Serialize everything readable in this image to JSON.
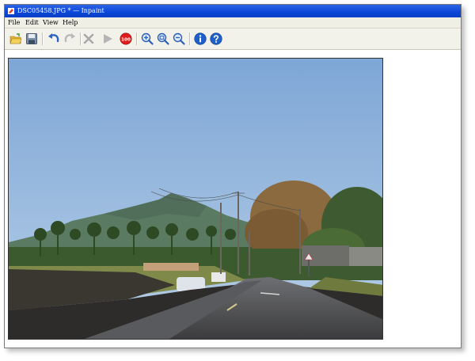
{
  "window": {
    "title": "DSC05458.JPG * — Inpaint"
  },
  "menu": {
    "items": [
      "File",
      "Edit",
      "View",
      "Help"
    ]
  },
  "toolbar": {
    "buttons": [
      {
        "icon": "open-icon"
      },
      {
        "icon": "save-icon"
      },
      {
        "icon": "undo-icon"
      },
      {
        "icon": "redo-icon"
      },
      {
        "icon": "delete-icon"
      },
      {
        "icon": "play-icon"
      },
      {
        "icon": "zoom-100-icon",
        "label": "100"
      },
      {
        "icon": "zoom-in-icon"
      },
      {
        "icon": "zoom-fit-icon"
      },
      {
        "icon": "zoom-out-icon"
      },
      {
        "icon": "info-icon"
      },
      {
        "icon": "help-icon"
      }
    ]
  },
  "colors": {
    "titlebar": "#0a46d8",
    "toolbar_bg": "#f3f2ea",
    "sky": "#8fb1d8"
  }
}
